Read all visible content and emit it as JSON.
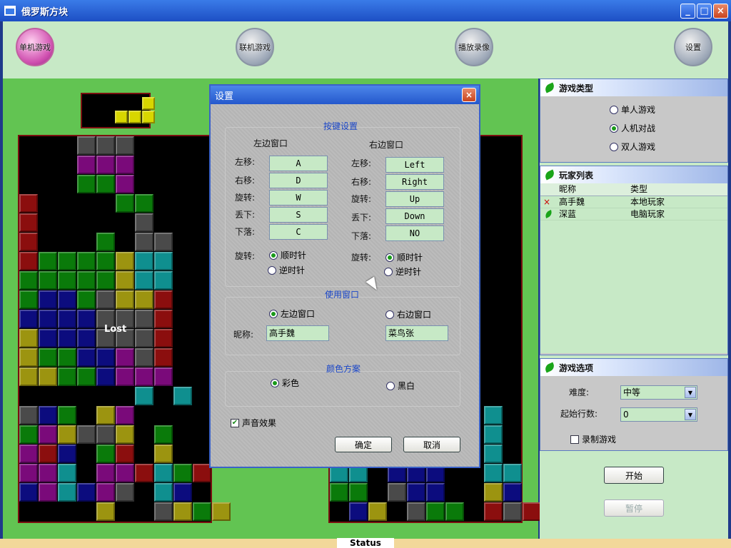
{
  "window": {
    "title": "俄罗斯方块"
  },
  "toolbar": [
    {
      "label": "单机游戏",
      "active": true
    },
    {
      "label": "联机游戏",
      "active": false
    },
    {
      "label": "播放录像",
      "active": false
    },
    {
      "label": "设置",
      "active": false
    }
  ],
  "game": {
    "lost_text": "Lost"
  },
  "colors": {
    "R": "#8b0e0e",
    "G": "#0a7a0a",
    "P": "#7a0a7a",
    "Y": "#9c9410",
    "C": "#0f8f8f",
    "B": "#0c0c7e",
    "K": "#4a4a4a",
    "Q": "#d8d600"
  },
  "preview_grid": [
    "...Q",
    ".QQQ"
  ],
  "left_board": [
    "...KKK......",
    "...PPP......",
    "...GGP......",
    "R....GG.....",
    "R.....K.....",
    "R...G.KK....",
    "RGGGGYCC..R.",
    "GGGGGYCC..R.",
    "GBBGKYYR..R.",
    "BBBBKKKR..R.",
    "YBBBKKKR..R.",
    "YGGBBPKR..R.",
    "YYGGBPPP..R.",
    "......C.C.Y.",
    "KBG.YP....C.",
    "GPYKKY.G..Y.",
    "PRB.GR.Y..K.",
    "PPC.PPRCGR..",
    "BPCBPK.CB...",
    "....Y..KYGY."
  ],
  "right_board": [
    "........C...",
    "........C...",
    "........C...",
    "CC.BBB..CC..",
    "GG.KBB..YB..",
    ".BY.KGG.RKR."
  ],
  "side": {
    "game_type": {
      "title": "游戏类型",
      "options": [
        {
          "label": "单人游戏",
          "checked": false
        },
        {
          "label": "人机对战",
          "checked": true
        },
        {
          "label": "双人游戏",
          "checked": false
        }
      ]
    },
    "players": {
      "title": "玩家列表",
      "columns": [
        "昵称",
        "类型"
      ],
      "rows": [
        {
          "marker": "×",
          "name": "高手魏",
          "type": "本地玩家"
        },
        {
          "marker": "",
          "name": "深蓝",
          "type": "电脑玩家"
        }
      ]
    },
    "options": {
      "title": "游戏选项",
      "difficulty_label": "难度:",
      "difficulty_value": "中等",
      "start_rows_label": "起始行数:",
      "start_rows_value": "0",
      "record_label": "录制游戏"
    },
    "start_label": "开始",
    "pause_label": "暂停"
  },
  "status": {
    "text": "Status Pane"
  },
  "dialog": {
    "title": "设置",
    "keys_title": "按键设置",
    "left_window": "左边窗口",
    "right_window": "右边窗口",
    "key_labels": [
      "左移:",
      "右移:",
      "旋转:",
      "丢下:",
      "下落:"
    ],
    "left_keys": [
      "A",
      "D",
      "W",
      "S",
      "C"
    ],
    "right_keys": [
      "Left",
      "Right",
      "Up",
      "Down",
      "NO"
    ],
    "rotate_label": "旋转:",
    "clockwise": "顺时针",
    "counter": "逆时针",
    "use_window_title": "使用窗口",
    "use_left": "左边窗口",
    "use_right": "右边窗口",
    "nick_label": "昵称:",
    "left_nick": "高手魏",
    "right_nick": "菜鸟张",
    "color_title": "颜色方案",
    "color_option": "彩色",
    "bw_option": "黑白",
    "sound_label": "声音效果",
    "ok_label": "确定",
    "cancel_label": "取消"
  }
}
